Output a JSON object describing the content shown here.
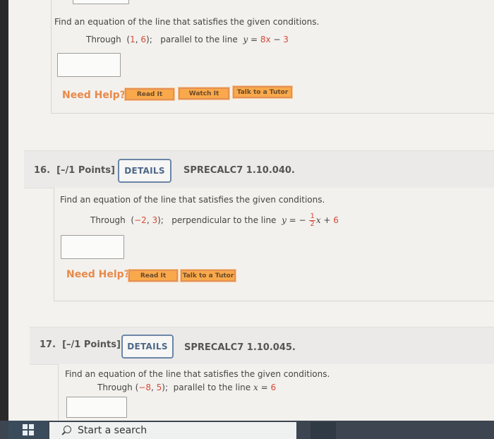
{
  "questions": [
    {
      "prompt": "Find an equation of the line that satisfies the given conditions.",
      "condition": {
        "prefix": "Through",
        "point_open": "(",
        "point_x": "1",
        "point_sep": ", ",
        "point_y": "6",
        "point_close": ");",
        "relation": "parallel to the line",
        "line_lhs": "y",
        "line_eq": " = ",
        "line_rhs_a": "8x",
        "line_rhs_op": " − ",
        "line_rhs_b": "3"
      },
      "answer_value": "",
      "need_help_label": "Need Help?",
      "help_buttons": [
        "Read It",
        "Watch It",
        "Talk to a Tutor"
      ]
    },
    {
      "number": "16.",
      "points": "[–/1 Points]",
      "details_label": "DETAILS",
      "code": "SPRECALC7 1.10.040.",
      "prompt": "Find an equation of the line that satisfies the given conditions.",
      "condition": {
        "prefix": "Through",
        "point_open": "(",
        "point_x": "−2",
        "point_sep": ", ",
        "point_y": "3",
        "point_close": ");",
        "relation": "perpendicular to the line",
        "line_lhs": "y",
        "line_eq": " = ",
        "line_neg": "−",
        "frac_num": "1",
        "frac_den": "2",
        "line_x": "x",
        "line_op": " + ",
        "line_b": "6"
      },
      "answer_value": "",
      "need_help_label": "Need Help?",
      "help_buttons": [
        "Read It",
        "Talk to a Tutor"
      ]
    },
    {
      "number": "17.",
      "points": "[–/1 Points]",
      "details_label": "DETAILS",
      "code": "SPRECALC7 1.10.045.",
      "prompt": "Find an equation of the line that satisfies the given conditions.",
      "condition": {
        "prefix": "Through",
        "point_open": "(",
        "point_x": "−8",
        "point_sep": ", ",
        "point_y": "5",
        "point_close": ");",
        "relation": "parallel to the line",
        "line_lhs": "x",
        "line_eq": " = ",
        "line_b": "6"
      },
      "answer_value": ""
    }
  ],
  "taskbar": {
    "search_placeholder": "Start a search"
  },
  "colors": {
    "accent_red": "#d44a3a",
    "need_help_orange": "#e8894a",
    "help_button_fill": "#f9a94b",
    "details_border": "#6b86a8"
  }
}
